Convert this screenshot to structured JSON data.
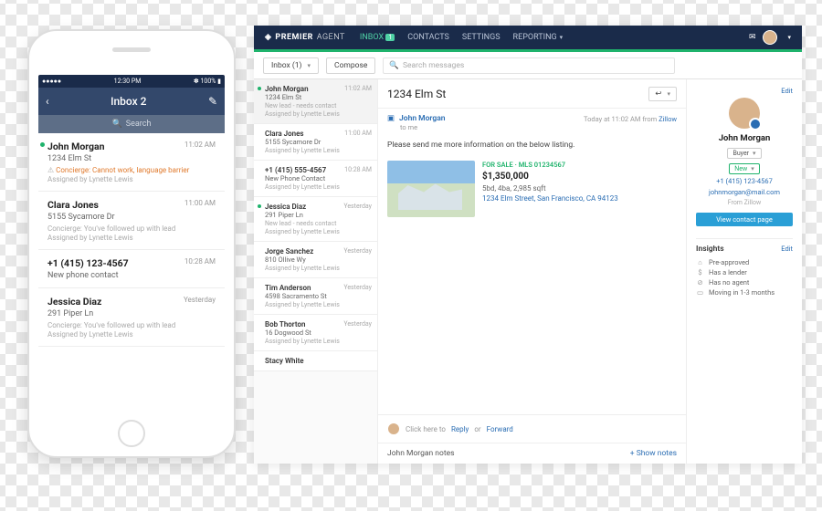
{
  "phone": {
    "status": {
      "left": "●●●●●",
      "time": "12:30 PM",
      "right": "✽ 100% ▮"
    },
    "header": {
      "back": "‹",
      "title": "Inbox 2",
      "compose": "✎"
    },
    "search": "Search",
    "leads": [
      {
        "name": "John Morgan",
        "sub": "1234 Elm St",
        "concierge": "Concierge: Cannot work, language barrier",
        "concierge_warn": true,
        "assigned": "Assigned by Lynette Lewis",
        "time": "11:02 AM",
        "active": true
      },
      {
        "name": "Clara Jones",
        "sub": "5155 Sycamore Dr",
        "concierge": "Concierge: You've followed up with lead",
        "assigned": "Assigned by Lynette Lewis",
        "time": "11:00 AM"
      },
      {
        "name": "+1 (415) 123-4567",
        "sub": "New phone contact",
        "time": "10:28 AM"
      },
      {
        "name": "Jessica Diaz",
        "sub": "291 Piper Ln",
        "concierge": "Concierge: You've followed up with lead",
        "assigned": "Assigned by Lynette Lewis",
        "time": "Yesterday"
      }
    ]
  },
  "desktop": {
    "brand_a": "PREMIER",
    "brand_b": "AGENT",
    "nav": [
      {
        "label": "INBOX",
        "active": true,
        "badge": "1"
      },
      {
        "label": "CONTACTS"
      },
      {
        "label": "SETTINGS"
      },
      {
        "label": "REPORTING",
        "caret": true
      }
    ],
    "toolbar": {
      "inbox_select": "Inbox (1)",
      "compose": "Compose",
      "search_placeholder": "Search messages"
    },
    "list": [
      {
        "name": "John Morgan",
        "sub": "1234 Elm St",
        "sub2a": "New lead - needs contact",
        "sub2b": "Assigned by Lynette Lewis",
        "time": "11:02 AM",
        "sel": true,
        "dot": true
      },
      {
        "name": "Clara Jones",
        "sub": "5155 Sycamore Dr",
        "sub2b": "Assigned by Lynette Lewis",
        "time": "11:00 AM"
      },
      {
        "name": "+1 (415) 555-4567",
        "sub": "New Phone Contact",
        "sub2b": "Assigned by Lynette Lewis",
        "time": "10:28 AM"
      },
      {
        "name": "Jessica Diaz",
        "sub": "291 Piper Ln",
        "sub2a": "New lead - needs contact",
        "sub2b": "Assigned by Lynette Lewis",
        "time": "Yesterday",
        "dot": true
      },
      {
        "name": "Jorge Sanchez",
        "sub": "810 Ollive Wy",
        "sub2b": "Assigned by Lynette Lewis",
        "time": "Yesterday"
      },
      {
        "name": "Tim Anderson",
        "sub": "4598 Sacramento St",
        "sub2b": "Assigned by Lynette Lewis",
        "time": "Yesterday"
      },
      {
        "name": "Bob Thorton",
        "sub": "16 Dogwood St",
        "sub2b": "Assigned by Lynette Lewis",
        "time": "Yesterday"
      },
      {
        "name": "Stacy White",
        "sub": ""
      }
    ],
    "thread": {
      "title": "1234 Elm St",
      "sender": "John Morgan",
      "to": "to me",
      "meta_time": "Today at 11:02 AM from",
      "meta_source": "Zillow",
      "body": "Please send me more information on the below listing.",
      "listing": {
        "status": "FOR SALE · MLS 01234567",
        "price": "$1,350,000",
        "specs": "5bd, 4ba, 2,985 sqft",
        "address": "1234 Elm Street, San Francisco, CA 94123"
      },
      "reply_prompt": "Click here to",
      "reply": "Reply",
      "or": "or",
      "forward": "Forward",
      "notes_title": "John Morgan notes",
      "show_notes": "+ Show notes"
    },
    "panel": {
      "edit": "Edit",
      "name": "John Morgan",
      "buyer": "Buyer",
      "new": "New",
      "phone": "+1 (415) 123-4567",
      "email": "johnmorgan@mail.com",
      "from": "From Zillow",
      "view_contact": "View contact page",
      "insights_h": "Insights",
      "insights": [
        {
          "icon": "⌂",
          "label": "Pre-approved"
        },
        {
          "icon": "$",
          "label": "Has a lender"
        },
        {
          "icon": "⊘",
          "label": "Has no agent"
        },
        {
          "icon": "▭",
          "label": "Moving in 1-3 months"
        }
      ]
    }
  }
}
